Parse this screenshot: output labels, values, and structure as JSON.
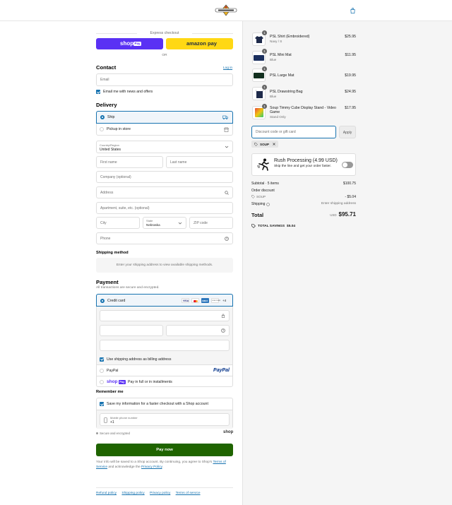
{
  "header": {
    "logo": "shop-logo",
    "cart_icon": "shopping-bag-icon"
  },
  "express": {
    "label": "Express checkout",
    "shop_pay": "shop",
    "shop_pay_badge": "Pay",
    "amazon_pay": "amazon pay",
    "or": "OR"
  },
  "contact": {
    "title": "Contact",
    "login": "Log in",
    "email_placeholder": "Email",
    "news_label": "Email me with news and offers"
  },
  "delivery": {
    "title": "Delivery",
    "ship": "Ship",
    "pickup": "Pickup in store",
    "country_label": "Country/Region",
    "country_value": "United States",
    "first_name": "First name",
    "last_name": "Last name",
    "company": "Company (optional)",
    "address": "Address",
    "apartment": "Apartment, suite, etc. (optional)",
    "city": "City",
    "state_label": "State",
    "state_value": "Nebraska",
    "zip": "ZIP code",
    "phone": "Phone"
  },
  "shipping_method": {
    "title": "Shipping method",
    "message": "Enter your shipping address to view available shipping methods."
  },
  "payment": {
    "title": "Payment",
    "subtitle": "All transactions are secure and encrypted.",
    "credit_card": "Credit card",
    "card_brands": [
      "VISA",
      "MC",
      "AMEX",
      "DISCOVER"
    ],
    "more_brands": "+4",
    "billing_same": "Use shipping address as billing address",
    "paypal": "PayPal",
    "paypal_logo": "PayPal",
    "shop_pay": "shop",
    "shop_pay_badge": "Pay",
    "shop_pay_text": "Pay in full or in installments"
  },
  "remember": {
    "title": "Remember me",
    "save_label": "Save my information for a faster checkout with a Shop account",
    "mobile_label": "Mobile phone number",
    "mobile_value": "+1",
    "secure": "Secure and encrypted",
    "shop": "shop"
  },
  "pay_now": "Pay now",
  "legal": {
    "text1": "Your info will be saved to a Shop account. By continuing, you agree to Shop's",
    "tos": "Terms of Service",
    "and": " and acknowledge the ",
    "privacy": "Privacy Policy",
    "period": "."
  },
  "footer_links": [
    "Refund policy",
    "Shipping policy",
    "Privacy policy",
    "Terms of service"
  ],
  "cart": {
    "items": [
      {
        "name": "PSL Shirt (Embroidered)",
        "variant": "Navy / S",
        "price": "$25.95",
        "qty": "1"
      },
      {
        "name": "PSL Mini Mat",
        "variant": "Blue",
        "price": "$11.95",
        "qty": "1"
      },
      {
        "name": "PSL Large Mat",
        "variant": "",
        "price": "$19.95",
        "qty": "1"
      },
      {
        "name": "PSL Drawstring Bag",
        "variant": "Blue",
        "price": "$24.95",
        "qty": "1"
      },
      {
        "name": "Soup Timmy Cube Display Stand - Video Game",
        "variant": "Stand Only",
        "price": "$17.95",
        "qty": "1"
      }
    ],
    "discount_placeholder": "Discount code or gift card",
    "apply": "Apply",
    "code_tag": "SOUP",
    "rush_title": "Rush Processing (4.99 USD)",
    "rush_sub": "Skip the line and get your order faster.",
    "subtotal_label": "Subtotal · 5 items",
    "subtotal": "$100.75",
    "order_discount": "Order discount",
    "discount_code": "SOUP",
    "discount_amount": "- $5.04",
    "shipping_label": "Shipping",
    "shipping_value": "Enter shipping address",
    "total_label": "Total",
    "currency": "USD",
    "total": "$95.71",
    "savings_label": "TOTAL SAVINGS",
    "savings": "$5.04"
  }
}
